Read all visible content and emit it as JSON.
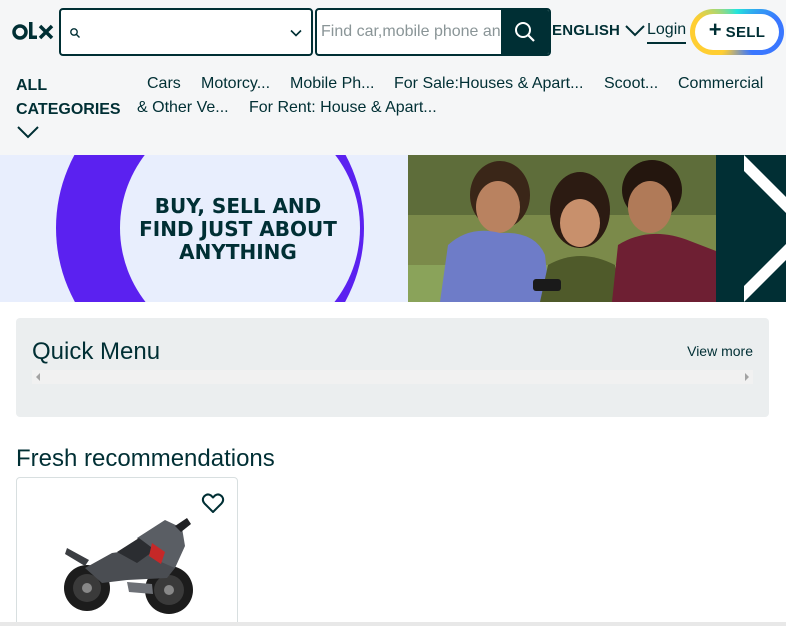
{
  "header": {
    "logo_icon": "olx-logo",
    "location_value": "",
    "search_placeholder": "Find car,mobile phone and more...",
    "language": "ENGLISH",
    "login": "Login",
    "sell_plus": "+",
    "sell": "SELL",
    "colors": {
      "primary": "#002f34",
      "sell_ring": [
        "#23e5db",
        "#3a77ff",
        "#ffce32"
      ]
    }
  },
  "categories": {
    "all_line1": "ALL",
    "all_line2": "CATEGORIES",
    "items": [
      "Cars",
      "Motorcy...",
      "Mobile Ph...",
      "For Sale:Houses & Apart...",
      "Scoot...",
      "Commercial",
      "& Other Ve...",
      "For Rent: House & Apart..."
    ]
  },
  "banner": {
    "line1": "BUY, SELL AND",
    "line2": "FIND JUST ABOUT",
    "line3": "ANYTHING",
    "colors": {
      "bg": "#e8eefd",
      "ring": "#5b21f0",
      "dark": "#012f34"
    }
  },
  "quick_menu": {
    "title": "Quick Menu",
    "view_more": "View more"
  },
  "fresh": {
    "title": "Fresh recommendations",
    "cards": [
      {
        "image": "motorcycle-image",
        "favorite_icon": "heart-icon"
      }
    ]
  }
}
